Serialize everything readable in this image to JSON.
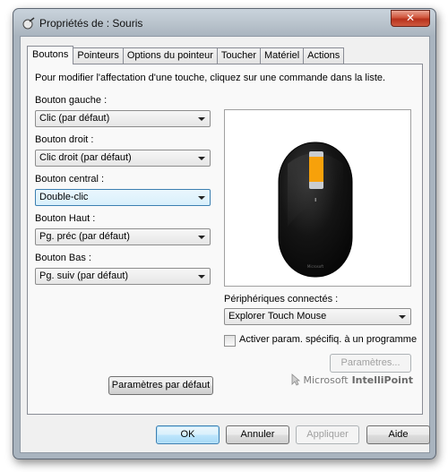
{
  "window": {
    "title": "Propriétés de : Souris",
    "title_icon": "mouse-icon",
    "close_glyph": "✕"
  },
  "tabs": [
    {
      "label": "Boutons",
      "active": true
    },
    {
      "label": "Pointeurs",
      "active": false
    },
    {
      "label": "Options du pointeur",
      "active": false
    },
    {
      "label": "Toucher",
      "active": false
    },
    {
      "label": "Matériel",
      "active": false
    },
    {
      "label": "Actions",
      "active": false
    }
  ],
  "buttons_tab": {
    "instruction": "Pour modifier l'affectation d'une touche, cliquez sur une commande dans la liste.",
    "assignments": [
      {
        "label": "Bouton gauche :",
        "value": "Clic (par défaut)"
      },
      {
        "label": "Bouton droit :",
        "value": "Clic droit (par défaut)"
      },
      {
        "label": "Bouton central :",
        "value": "Double-clic",
        "focused": true
      },
      {
        "label": "Bouton Haut :",
        "value": "Pg. préc (par défaut)"
      },
      {
        "label": "Bouton Bas :",
        "value": "Pg. suiv (par défaut)"
      }
    ],
    "preview": {
      "device_image": "mouse-image",
      "highlight_color": "#f7a10a",
      "body_color": "#111111"
    },
    "connected_devices_label": "Périphériques connectés :",
    "connected_device": "Explorer Touch Mouse",
    "app_specific_checkbox": {
      "label": "Activer param. spécifiq. à un programme",
      "checked": false
    },
    "settings_button": "Paramètres...",
    "defaults_button": "Paramètres par défaut",
    "brand": {
      "prefix": "Microsoft",
      "name": "IntelliPoint"
    }
  },
  "footer": {
    "ok": "OK",
    "cancel": "Annuler",
    "apply": "Appliquer",
    "help": "Aide"
  }
}
